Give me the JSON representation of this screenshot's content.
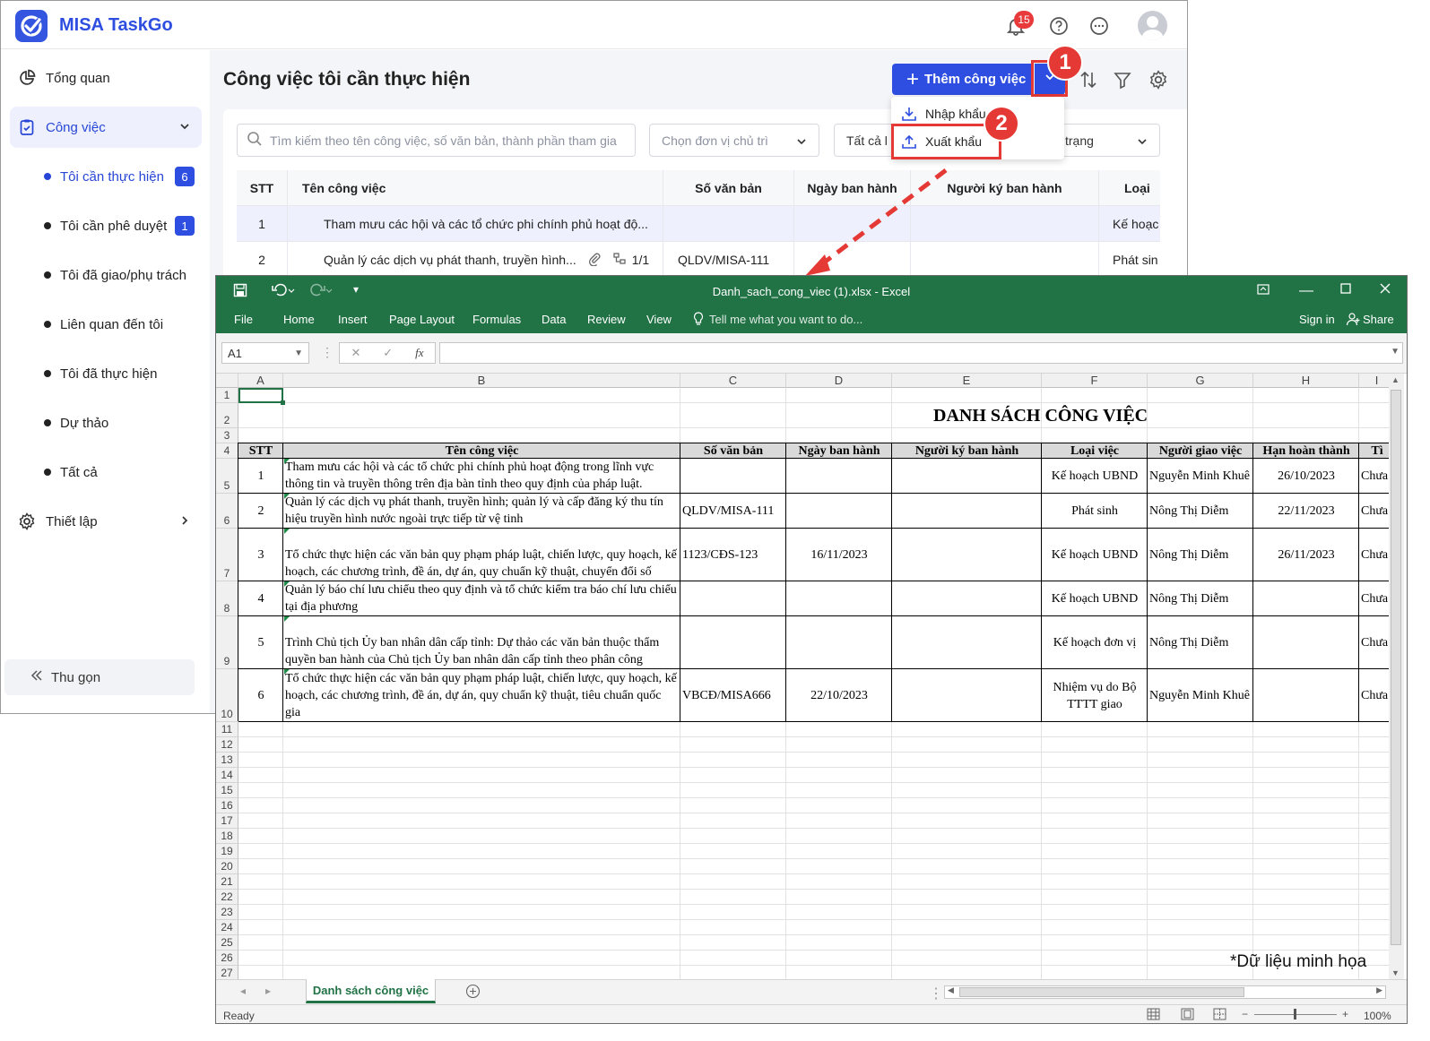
{
  "app": {
    "name": "MISA TaskGo",
    "notification_count": "15"
  },
  "sidebar": {
    "items": [
      {
        "label": "Tổng quan"
      },
      {
        "label": "Công việc"
      },
      {
        "label": "Thiết lập"
      }
    ],
    "sub_items": [
      {
        "label": "Tôi cần thực hiện",
        "count": "6"
      },
      {
        "label": "Tôi cần phê duyệt",
        "count": "1"
      },
      {
        "label": "Tôi đã giao/phụ trách"
      },
      {
        "label": "Liên quan đến tôi"
      },
      {
        "label": "Tôi đã thực hiện"
      },
      {
        "label": "Dự thảo"
      },
      {
        "label": "Tất cả"
      }
    ],
    "collapse_label": "Thu gọn"
  },
  "main": {
    "title": "Công việc tôi cần thực hiện",
    "add_button": "Thêm công việc",
    "search_placeholder": "Tìm kiếm theo tên công việc, số văn bản, thành phần tham gia",
    "unit_select": "Chọn đơn vị chủ trì",
    "status_select_left": "Tất cả l",
    "status_select_right": "trạng",
    "menu": {
      "import": "Nhập khẩu",
      "export": "Xuất khẩu"
    },
    "steps": [
      "1",
      "2"
    ],
    "columns": [
      "STT",
      "Tên công việc",
      "Số văn bản",
      "Ngày ban hành",
      "Người ký ban hành",
      "Loại"
    ],
    "rows": [
      {
        "stt": "1",
        "name": "Tham mưu các hội và các tổ chức phi chính phủ hoạt độ...",
        "doc": "",
        "date": "",
        "signer": "",
        "type": "Kế hoạc"
      },
      {
        "stt": "2",
        "name": "Quản lý các dịch vụ phát thanh, truyền hình...",
        "attach": "1/1",
        "doc": "QLDV/MISA-111",
        "date": "",
        "signer": "",
        "type": "Phát sin"
      }
    ]
  },
  "excel": {
    "title": "Danh_sach_cong_viec (1).xlsx - Excel",
    "tabs": [
      "File",
      "Home",
      "Insert",
      "Page Layout",
      "Formulas",
      "Data",
      "Review",
      "View"
    ],
    "tell_me": "Tell me what you want to do...",
    "sign_in": "Sign in",
    "share": "Share",
    "name_box": "A1",
    "fx": "fx",
    "col_letters": [
      "A",
      "B",
      "C",
      "D",
      "E",
      "F",
      "G",
      "H",
      "I"
    ],
    "sheet_title": "DANH SÁCH CÔNG VIỆC",
    "headers": [
      "STT",
      "Tên công việc",
      "Số văn bản",
      "Ngày ban hành",
      "Người ký ban hành",
      "Loại việc",
      "Người giao việc",
      "Hạn hoàn thành",
      "Tì"
    ],
    "rows": [
      {
        "stt": "1",
        "name": "Tham mưu các hội và các tổ chức phi chính phủ hoạt động trong lĩnh vực thông tin và truyền thông trên địa bàn tỉnh theo quy định của pháp luật.",
        "doc": "",
        "date": "",
        "signer": "",
        "type": "Kế hoạch UBND",
        "assigner": "Nguyễn Minh Khuê",
        "deadline": "26/10/2023",
        "status": "Chưa"
      },
      {
        "stt": "2",
        "name": "Quản lý các dịch vụ phát thanh, truyền hình; quản lý và cấp đăng ký thu tín hiệu truyền hình nước ngoài trực tiếp từ vệ tinh",
        "doc": "QLDV/MISA-111",
        "date": "",
        "signer": "",
        "type": "Phát sinh",
        "assigner": "Nông Thị Diễm",
        "deadline": "22/11/2023",
        "status": "Chưa"
      },
      {
        "stt": "3",
        "name": "Tổ chức thực hiện các văn bản quy phạm pháp luật, chiến lược, quy hoạch, kế hoạch, các chương trình, đề án, dự án, quy chuẩn kỹ thuật, chuyển đổi số",
        "doc": "1123/CĐS-123",
        "date": "16/11/2023",
        "signer": "",
        "type": "Kế hoạch UBND",
        "assigner": "Nông Thị Diễm",
        "deadline": "26/11/2023",
        "status": "Chưa"
      },
      {
        "stt": "4",
        "name": "Quản lý báo chí lưu chiểu theo quy định và tổ chức kiểm tra báo chí lưu chiểu tại địa phương",
        "doc": "",
        "date": "",
        "signer": "",
        "type": "Kế hoạch UBND",
        "assigner": "Nông Thị Diễm",
        "deadline": "",
        "status": "Chưa"
      },
      {
        "stt": "5",
        "name": "Trình Chủ tịch Ủy ban nhân dân cấp tỉnh: Dự thảo các văn bản thuộc thẩm quyền ban hành của Chủ tịch Ủy ban nhân dân cấp tỉnh theo phân công",
        "doc": "",
        "date": "",
        "signer": "",
        "type": "Kế hoạch đơn vị",
        "assigner": "Nông Thị Diễm",
        "deadline": "",
        "status": "Chưa"
      },
      {
        "stt": "6",
        "name": "Tổ chức thực hiện các văn bản quy phạm pháp luật, chiến lược, quy hoạch, kế hoạch, các chương trình, đề án, dự án, quy chuẩn kỹ thuật, tiêu chuẩn quốc gia",
        "doc": "VBCĐ/MISA666",
        "date": "22/10/2023",
        "signer": "",
        "type": "Nhiệm vụ do Bộ TTTT giao",
        "assigner": "Nguyễn Minh Khuê",
        "deadline": "",
        "status": "Chưa"
      }
    ],
    "row_numbers": [
      "1",
      "2",
      "3",
      "4",
      "5",
      "6",
      "7",
      "8",
      "9",
      "10",
      "11",
      "12",
      "13",
      "14",
      "15",
      "16",
      "17",
      "18",
      "19",
      "20",
      "21",
      "22",
      "23",
      "24",
      "25",
      "26",
      "27"
    ],
    "sheet_tab": "Danh sách công việc",
    "status": "Ready",
    "zoom": "100%"
  },
  "footnote": "*Dữ liệu minh họa"
}
